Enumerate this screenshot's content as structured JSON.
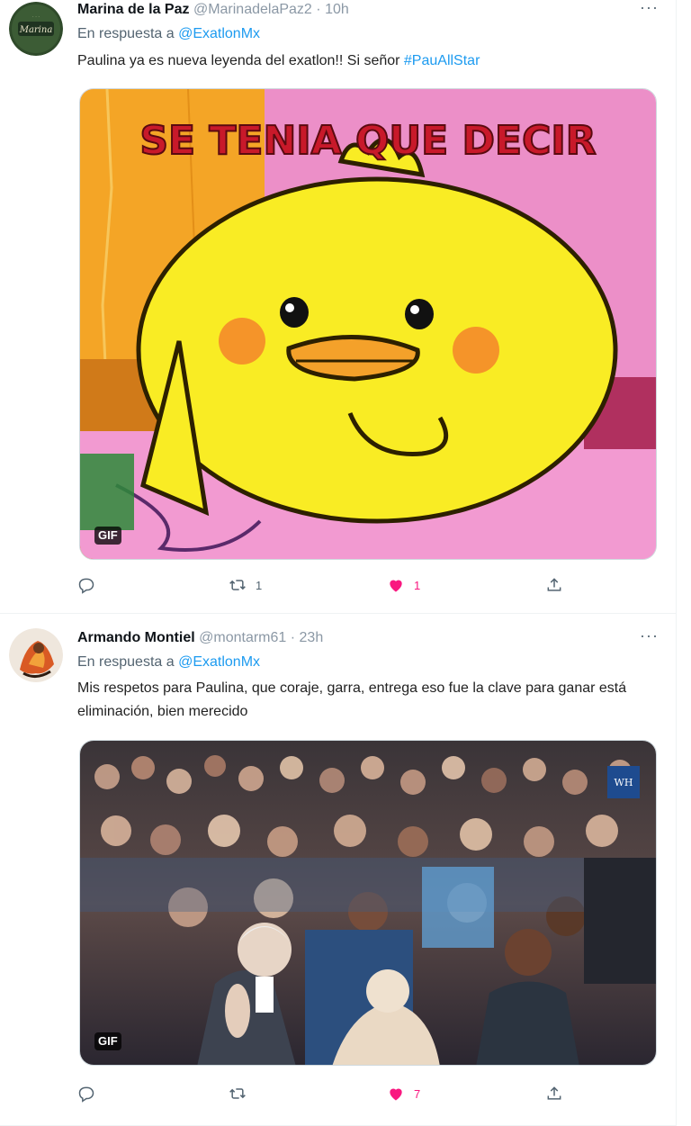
{
  "tweets": [
    {
      "display_name": "Marina de la Paz",
      "handle": "@MarinadelaPaz2",
      "separator": "·",
      "time": "10h",
      "more": "···",
      "reply_prefix": "En respuesta a",
      "reply_mention": "@ExatlonMx",
      "text": "Paulina ya es nueva leyenda del exatlon!! Si señor ",
      "hashtag": "#PauAllStar",
      "media_label": "GIF",
      "media_caption": "SE TENIA QUE DECIR",
      "avatar_text": "Marina",
      "retweets": "1",
      "likes": "1",
      "replies": ""
    },
    {
      "display_name": "Armando Montiel",
      "handle": "@montarm61",
      "separator": "·",
      "time": "23h",
      "more": "···",
      "reply_prefix": "En respuesta a",
      "reply_mention": "@ExatlonMx",
      "text": "Mis respetos para Paulina, que coraje, garra, entrega eso fue la clave para ganar está eliminación, bien merecido",
      "media_label": "GIF",
      "media_watermark": "WH",
      "retweets": "",
      "likes": "7",
      "replies": ""
    }
  ],
  "colors": {
    "link": "#1d9bf0",
    "like": "#f91880",
    "muted": "#536471"
  },
  "icons": [
    "reply-icon",
    "retweet-icon",
    "heart-icon",
    "share-icon",
    "more-icon"
  ]
}
